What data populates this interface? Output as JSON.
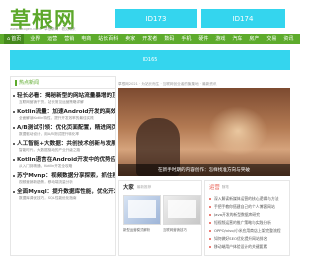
{
  "header": {
    "logo": "草根网",
    "url": "www.caogen.com · 草根新闻 · 看见未来",
    "ads": [
      "ID173",
      "ID174",
      "ID165"
    ]
  },
  "nav": {
    "items": [
      "首页",
      "业界",
      "运营",
      "营销",
      "电商",
      "站长百科",
      "卖家",
      "开发者",
      "数码",
      "手机",
      "硬件",
      "游戏",
      "汽车",
      "房产",
      "交易",
      "资讯",
      "注册"
    ]
  },
  "hot": {
    "title": "热点新闻",
    "items": [
      {
        "title": "轻长必看：揭秘新型的网站流量暴增的顶级秘诀",
        "desc": "互联网营销干货，站长常见运营策略详解"
      },
      {
        "title": "Kotlin流量：加速Android开发的高效编程秘籍",
        "desc": "全面解读Kotlin特性，提升开发效率的最佳实践"
      },
      {
        "title": "A/B测试引领：优化页面配置，精进网页设计策略",
        "desc": "数据驱动设计，用A/B测试提升转化率"
      },
      {
        "title": "人工智能+大数据：共创技术创新与发展的新篇章",
        "desc": "智能时代，大数据驱动的产业升级之路"
      },
      {
        "title": "Kotlin语言在Android开发中的优势应用与实践",
        "desc": "从入门到精通，Kotlin开发全攻略"
      },
      {
        "title": "苏宁Mvnp：视频数据分享探索，抓住移动互联网",
        "desc": "视频营销新趋势，移动端流量分析"
      },
      {
        "title": "全面Mysql：提升数据库性能，优化开发策略",
        "desc": "数据库调优技巧，SQL性能优化指南"
      }
    ]
  },
  "banner": {
    "caption": "草根网2021 · 为站长而生 · 互联网创业者的聚集地 · 最新资讯",
    "hero_title": "在新手时期的内容创作：怎样找准方向与突破"
  },
  "card_a": {
    "title": "大家",
    "sub": "最新推荐",
    "captions": [
      "新型运营模式解析",
      "互联网营销技巧"
    ]
  },
  "card_b": {
    "title": "运营",
    "sub": "随笔",
    "items": [
      "深入解读新媒体运营的核心逻辑与方法",
      "手把手教你搭建自己的个人博客网站",
      "Java开发的新型数据库研究",
      "短视频运营的推广策略与实践分析",
      "OPPO/vivo/小米应用商店上架完整流程",
      "如何做好SEO优化提升网站排名",
      "移动端用户体验设计的关键要素",
      "iOS 15系统最新功能全面体验报告",
      "社交电商的发展现状与未来趋势"
    ]
  }
}
